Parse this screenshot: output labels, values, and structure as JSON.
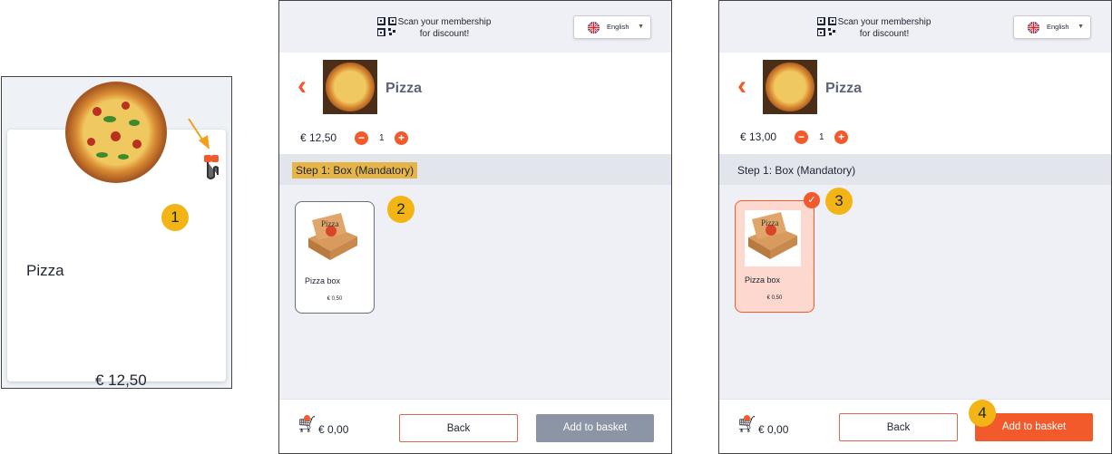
{
  "panel1": {
    "name": "Pizza",
    "price": "€ 12,50",
    "add_symbol": "+",
    "badge": "1"
  },
  "panel2": {
    "scan_line1": "Scan your membership",
    "scan_line2": "for discount!",
    "language": "English",
    "product_title": "Pizza",
    "price": "€ 12,50",
    "quantity": "1",
    "minus": "−",
    "plus": "+",
    "step_label": "Step 1: Box (Mandatory)",
    "item_name": "Pizza box",
    "item_price": "€ 0,50",
    "badge": "2",
    "total": "€ 0,00",
    "back_label": "Back",
    "add_label": "Add to basket"
  },
  "panel3": {
    "scan_line1": "Scan your membership",
    "scan_line2": "for discount!",
    "language": "English",
    "product_title": "Pizza",
    "price": "€ 13,00",
    "quantity": "1",
    "minus": "−",
    "plus": "+",
    "step_label": "Step 1: Box (Mandatory)",
    "item_name": "Pizza box",
    "item_price": "€ 0,50",
    "badge_selected": "3",
    "badge_add": "4",
    "total": "€ 0,00",
    "back_label": "Back",
    "add_label": "Add to basket"
  },
  "colors": {
    "accent": "#f25a2c",
    "badge": "#f2b515",
    "step_highlight": "#e6b54a",
    "disabled_button": "#8c95a6"
  },
  "icons": [
    "back-chevron-icon",
    "qr-code-icon",
    "uk-flag-icon",
    "cart-icon",
    "check-icon",
    "pointer-hand-icon"
  ]
}
